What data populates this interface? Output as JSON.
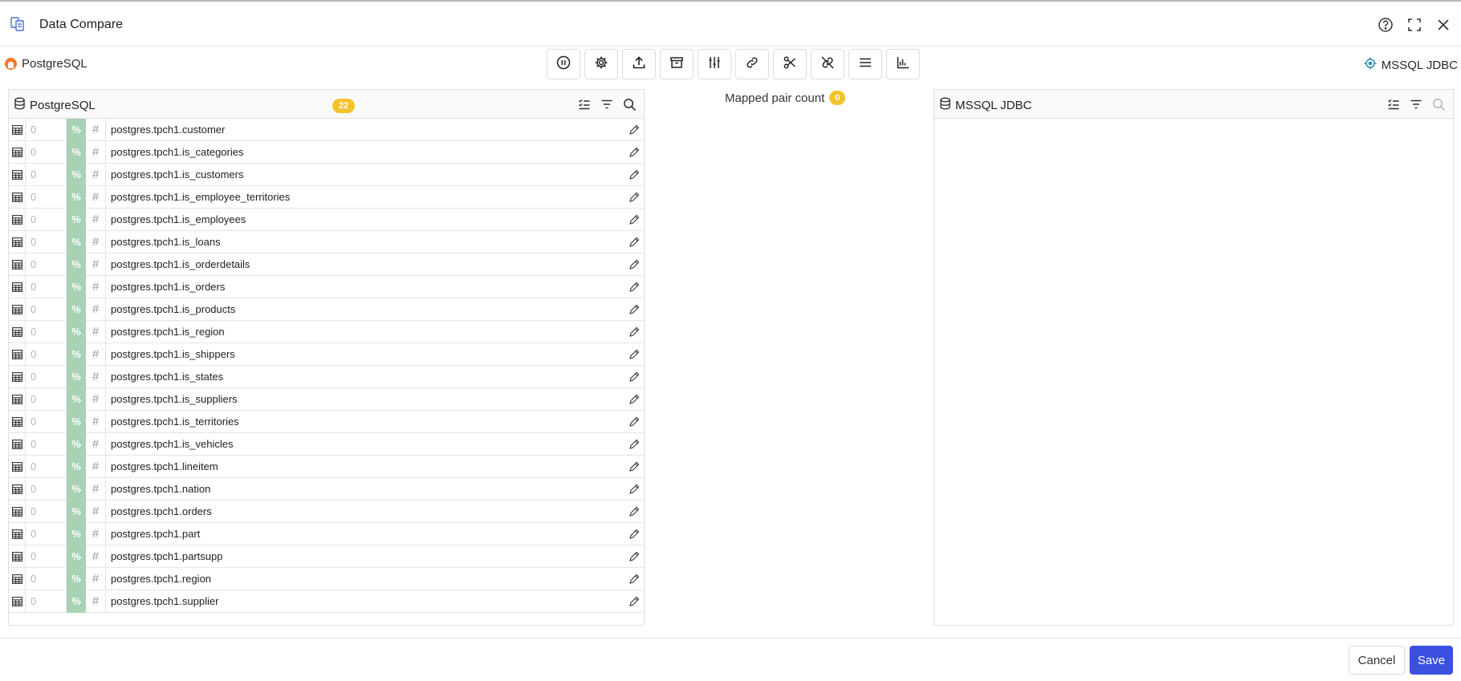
{
  "window": {
    "title": "Data Compare",
    "icons": {
      "app": "compare-documents-icon",
      "help": "help-circle-icon",
      "fullscreen": "fullscreen-icon",
      "close": "close-icon"
    }
  },
  "connections": {
    "source": {
      "label": "PostgreSQL",
      "icon": "postgresql-icon"
    },
    "target": {
      "label": "MSSQL JDBC",
      "icon": "mssql-target-icon"
    }
  },
  "toolbar": {
    "buttons": [
      "pause-icon",
      "settings-icon",
      "upload-icon",
      "archive-icon",
      "sliders-icon",
      "link-icon",
      "scissors-icon",
      "unlink-icon",
      "list-icon",
      "chart-axis-icon"
    ]
  },
  "left_panel": {
    "title": "PostgreSQL",
    "count": "22",
    "actions": [
      "checklist-icon",
      "filter-icon",
      "search-icon"
    ],
    "rows": [
      {
        "count": "0",
        "pct": "%",
        "hash": "#",
        "name": "postgres.tpch1.customer"
      },
      {
        "count": "0",
        "pct": "%",
        "hash": "#",
        "name": "postgres.tpch1.is_categories"
      },
      {
        "count": "0",
        "pct": "%",
        "hash": "#",
        "name": "postgres.tpch1.is_customers"
      },
      {
        "count": "0",
        "pct": "%",
        "hash": "#",
        "name": "postgres.tpch1.is_employee_territories"
      },
      {
        "count": "0",
        "pct": "%",
        "hash": "#",
        "name": "postgres.tpch1.is_employees"
      },
      {
        "count": "0",
        "pct": "%",
        "hash": "#",
        "name": "postgres.tpch1.is_loans"
      },
      {
        "count": "0",
        "pct": "%",
        "hash": "#",
        "name": "postgres.tpch1.is_orderdetails"
      },
      {
        "count": "0",
        "pct": "%",
        "hash": "#",
        "name": "postgres.tpch1.is_orders"
      },
      {
        "count": "0",
        "pct": "%",
        "hash": "#",
        "name": "postgres.tpch1.is_products"
      },
      {
        "count": "0",
        "pct": "%",
        "hash": "#",
        "name": "postgres.tpch1.is_region"
      },
      {
        "count": "0",
        "pct": "%",
        "hash": "#",
        "name": "postgres.tpch1.is_shippers"
      },
      {
        "count": "0",
        "pct": "%",
        "hash": "#",
        "name": "postgres.tpch1.is_states"
      },
      {
        "count": "0",
        "pct": "%",
        "hash": "#",
        "name": "postgres.tpch1.is_suppliers"
      },
      {
        "count": "0",
        "pct": "%",
        "hash": "#",
        "name": "postgres.tpch1.is_territories"
      },
      {
        "count": "0",
        "pct": "%",
        "hash": "#",
        "name": "postgres.tpch1.is_vehicles"
      },
      {
        "count": "0",
        "pct": "%",
        "hash": "#",
        "name": "postgres.tpch1.lineitem"
      },
      {
        "count": "0",
        "pct": "%",
        "hash": "#",
        "name": "postgres.tpch1.nation"
      },
      {
        "count": "0",
        "pct": "%",
        "hash": "#",
        "name": "postgres.tpch1.orders"
      },
      {
        "count": "0",
        "pct": "%",
        "hash": "#",
        "name": "postgres.tpch1.part"
      },
      {
        "count": "0",
        "pct": "%",
        "hash": "#",
        "name": "postgres.tpch1.partsupp"
      },
      {
        "count": "0",
        "pct": "%",
        "hash": "#",
        "name": "postgres.tpch1.region"
      },
      {
        "count": "0",
        "pct": "%",
        "hash": "#",
        "name": "postgres.tpch1.supplier"
      }
    ]
  },
  "mapping": {
    "label": "Mapped pair count",
    "count": "0"
  },
  "right_panel": {
    "title": "MSSQL JDBC",
    "actions": [
      "checklist-icon",
      "filter-icon",
      "search-icon"
    ]
  },
  "footer": {
    "cancel_label": "Cancel",
    "save_label": "Save"
  },
  "colors": {
    "accent": "#3b4fe0",
    "badge": "#f4c22b",
    "pct_cell": "#a9d1b4",
    "postgres": "#f07b2b",
    "mssql": "#2a8fb5"
  }
}
